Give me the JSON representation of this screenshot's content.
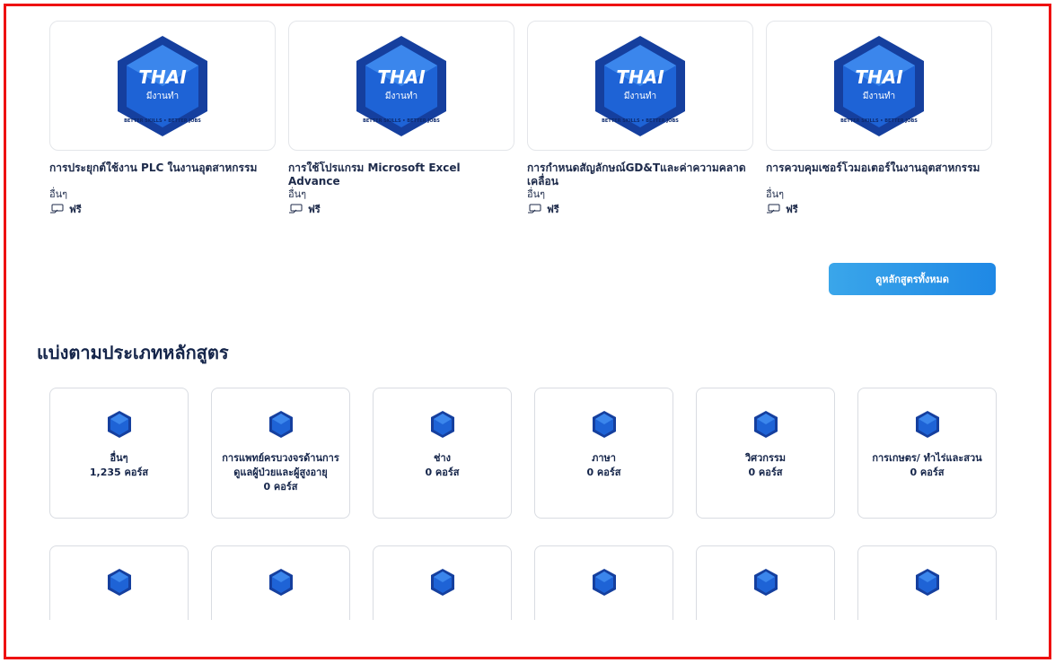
{
  "courses": [
    {
      "thumb_logo": "THAI",
      "thumb_sub": "มีงานทำ",
      "thumb_ring": "BETTER SKILLS • BETTER JOBS",
      "title": "การประยุกต์ใช้งาน PLC ในงานอุตสาหกรรม",
      "category": "อื่นๆ",
      "price": "ฟรี"
    },
    {
      "thumb_logo": "THAI",
      "thumb_sub": "มีงานทำ",
      "thumb_ring": "BETTER SKILLS • BETTER JOBS",
      "title": "การใช้โปรแกรม Microsoft Excel Advance",
      "category": "อื่นๆ",
      "price": "ฟรี"
    },
    {
      "thumb_logo": "THAI",
      "thumb_sub": "มีงานทำ",
      "thumb_ring": "BETTER SKILLS • BETTER JOBS",
      "title": "การกำหนดสัญลักษณ์GD&Tและค่าความคลาดเคลื่อน",
      "category": "อื่นๆ",
      "price": "ฟรี"
    },
    {
      "thumb_logo": "THAI",
      "thumb_sub": "มีงานทำ",
      "thumb_ring": "BETTER SKILLS • BETTER JOBS",
      "title": "การควบคุมเซอร์โวมอเตอร์ในงานอุตสาหกรรม",
      "category": "อื่นๆ",
      "price": "ฟรี"
    }
  ],
  "all_courses_button": "ดูหลักสูตรทั้งหมด",
  "section_title": "แบ่งตามประเภทหลักสูตร",
  "categories": [
    {
      "name": "อื่นๆ",
      "count": "1,235 คอร์ส"
    },
    {
      "name": "การแพทย์ครบวงจรด้านการดูแลผู้ป่วยและผู้สูงอายุ",
      "count": "0 คอร์ส"
    },
    {
      "name": "ช่าง",
      "count": "0 คอร์ส"
    },
    {
      "name": "ภาษา",
      "count": "0 คอร์ส"
    },
    {
      "name": "วิศวกรรม",
      "count": "0 คอร์ส"
    },
    {
      "name": "การเกษตร/ ทำไร่และสวน",
      "count": "0 คอร์ส"
    }
  ],
  "colors": {
    "frame": "#ee1111",
    "accent": "#1f88e5",
    "logo_blue": "#1d5fd1",
    "text": "#15254a"
  },
  "icons": {
    "price": "money-hand-icon",
    "logo": "thai-job-logo-icon"
  }
}
